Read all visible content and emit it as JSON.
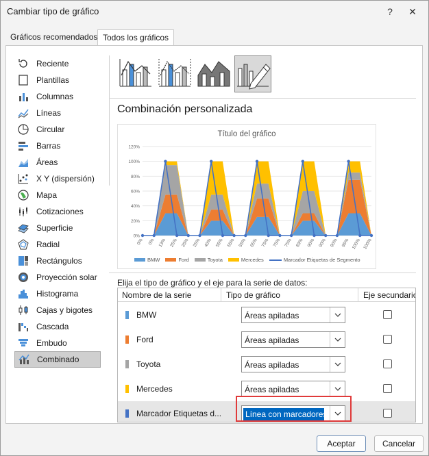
{
  "window": {
    "title": "Cambiar tipo de gráfico",
    "help_glyph": "?",
    "close_glyph": "✕"
  },
  "tabs": [
    {
      "label": "Gráficos recomendados",
      "active": false
    },
    {
      "label": "Todos los gráficos",
      "active": true
    }
  ],
  "sidebar": {
    "items": [
      {
        "label": "Reciente",
        "icon": "recent-icon"
      },
      {
        "label": "Plantillas",
        "icon": "templates-icon"
      },
      {
        "label": "Columnas",
        "icon": "column-chart-icon"
      },
      {
        "label": "Líneas",
        "icon": "line-chart-icon"
      },
      {
        "label": "Circular",
        "icon": "pie-chart-icon"
      },
      {
        "label": "Barras",
        "icon": "bar-chart-icon"
      },
      {
        "label": "Áreas",
        "icon": "area-chart-icon"
      },
      {
        "label": "X Y (dispersión)",
        "icon": "scatter-chart-icon"
      },
      {
        "label": "Mapa",
        "icon": "map-chart-icon"
      },
      {
        "label": "Cotizaciones",
        "icon": "stock-chart-icon"
      },
      {
        "label": "Superficie",
        "icon": "surface-chart-icon"
      },
      {
        "label": "Radial",
        "icon": "radar-chart-icon"
      },
      {
        "label": "Rectángulos",
        "icon": "treemap-chart-icon"
      },
      {
        "label": "Proyección solar",
        "icon": "sunburst-chart-icon"
      },
      {
        "label": "Histograma",
        "icon": "histogram-chart-icon"
      },
      {
        "label": "Cajas y bigotes",
        "icon": "box-whisker-chart-icon"
      },
      {
        "label": "Cascada",
        "icon": "waterfall-chart-icon"
      },
      {
        "label": "Embudo",
        "icon": "funnel-chart-icon"
      },
      {
        "label": "Combinado",
        "icon": "combo-chart-icon",
        "selected": true
      }
    ]
  },
  "subtypes": [
    {
      "icon": "combo-column-line-icon",
      "active": false
    },
    {
      "icon": "combo-column-line-secondary-icon",
      "active": false
    },
    {
      "icon": "combo-area-column-icon",
      "active": false
    },
    {
      "icon": "custom-combo-icon",
      "active": true
    }
  ],
  "section_title": "Combinación personalizada",
  "chart_data": {
    "type": "area",
    "title": "Título del gráfico",
    "categories": [
      "0%",
      "0%",
      "13%",
      "25%",
      "25%",
      "25%",
      "40%",
      "55%",
      "55%",
      "55%",
      "65%",
      "75%",
      "75%",
      "75%",
      "83%",
      "90%",
      "90%",
      "90%",
      "95%",
      "100%",
      "100%"
    ],
    "ylim": [
      0,
      1.2
    ],
    "yticks": [
      "0%",
      "20%",
      "40%",
      "60%",
      "80%",
      "100%",
      "120%"
    ],
    "grid": true,
    "legend_position": "bottom",
    "series": [
      {
        "name": "BMW",
        "kind": "stacked-area",
        "color": "#5b9bd5",
        "values": [
          0,
          0,
          0.3,
          0.3,
          0,
          0,
          0.2,
          0.2,
          0,
          0,
          0.25,
          0.25,
          0,
          0,
          0.2,
          0.2,
          0,
          0,
          0.3,
          0.3,
          0
        ]
      },
      {
        "name": "Ford",
        "kind": "stacked-area",
        "color": "#ed7d31",
        "values": [
          0,
          0,
          0.25,
          0.25,
          0,
          0,
          0.15,
          0.15,
          0,
          0,
          0.25,
          0.25,
          0,
          0,
          0.1,
          0.1,
          0,
          0,
          0.45,
          0.45,
          0
        ]
      },
      {
        "name": "Toyota",
        "kind": "stacked-area",
        "color": "#a5a5a5",
        "values": [
          0,
          0,
          0.4,
          0.4,
          0,
          0,
          0.2,
          0.2,
          0,
          0,
          0.2,
          0.2,
          0,
          0,
          0.3,
          0.3,
          0,
          0,
          0.1,
          0.1,
          0
        ]
      },
      {
        "name": "Mercedes",
        "kind": "stacked-area",
        "color": "#ffc000",
        "values": [
          0,
          0,
          0.05,
          0.05,
          0,
          0,
          0.45,
          0.45,
          0,
          0,
          0.3,
          0.3,
          0,
          0,
          0.4,
          0.4,
          0,
          0,
          0.15,
          0.15,
          0
        ]
      },
      {
        "name": "Marcador Etiquetas de Segmento",
        "kind": "line-markers",
        "color": "#4472c4",
        "values": [
          0,
          0,
          1.0,
          0,
          0,
          0,
          1.0,
          0,
          0,
          0,
          1.0,
          0,
          0,
          0,
          1.0,
          0,
          0,
          0,
          1.0,
          0,
          0
        ]
      }
    ]
  },
  "series_prompt": "Elija el tipo de gráfico y el eje para la serie de datos:",
  "grid_headers": {
    "name": "Nombre de la serie",
    "type": "Tipo de gráfico",
    "secondary": "Eje secundario"
  },
  "series_rows": [
    {
      "name": "BMW",
      "color": "#5b9bd5",
      "type": "Áreas apiladas",
      "secondary": false
    },
    {
      "name": "Ford",
      "color": "#ed7d31",
      "type": "Áreas apiladas",
      "secondary": false
    },
    {
      "name": "Toyota",
      "color": "#a5a5a5",
      "type": "Áreas apiladas",
      "secondary": false
    },
    {
      "name": "Mercedes",
      "color": "#ffc000",
      "type": "Áreas apiladas",
      "secondary": false
    },
    {
      "name": "Marcador Etiquetas d...",
      "color": "#4472c4",
      "type": "Línea con marcadores",
      "secondary": false,
      "selected": true
    }
  ],
  "buttons": {
    "ok": "Aceptar",
    "cancel": "Cancelar"
  }
}
